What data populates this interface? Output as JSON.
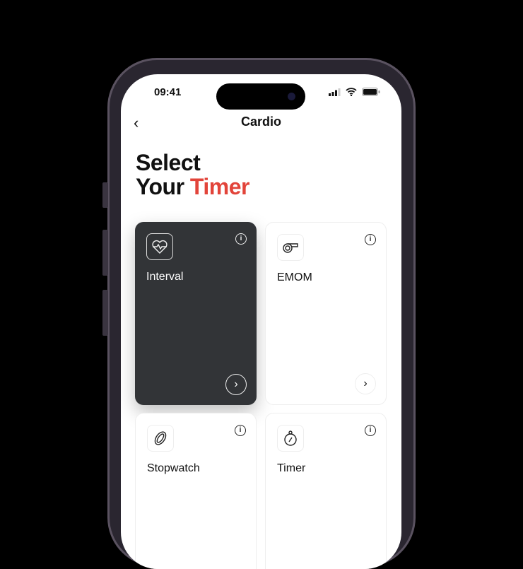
{
  "status": {
    "time": "09:41"
  },
  "nav": {
    "back": "‹",
    "title": "Cardio"
  },
  "heading": {
    "line1": "Select",
    "line2_a": "Your ",
    "line2_b": "Timer"
  },
  "accent": "#e2443a",
  "cards": [
    {
      "label": "Interval",
      "icon": "heart-pulse-icon",
      "selected": true
    },
    {
      "label": "EMOM",
      "icon": "whistle-icon",
      "selected": false
    },
    {
      "label": "Stopwatch",
      "icon": "link-icon",
      "selected": false
    },
    {
      "label": "Timer",
      "icon": "stopwatch-icon",
      "selected": false
    }
  ],
  "info_glyph": "i",
  "chevron_glyph": "›"
}
